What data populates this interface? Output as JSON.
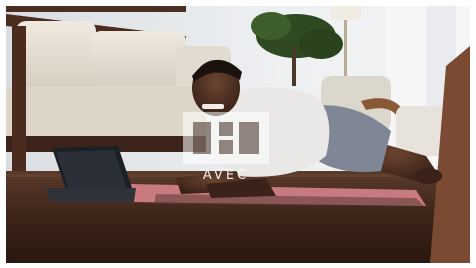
{
  "photo": {
    "description_hidden": "",
    "watermark": {
      "text": "AVEC",
      "color": "#ffffff"
    }
  },
  "colors": {
    "floor": "#3b231a",
    "wall": "#e9eaec",
    "sofa": "#e5ded2",
    "shirt": "#e9e8e6",
    "shorts": "#7f8796",
    "mat": "#c87a7f",
    "tablet": "#1f2328"
  }
}
